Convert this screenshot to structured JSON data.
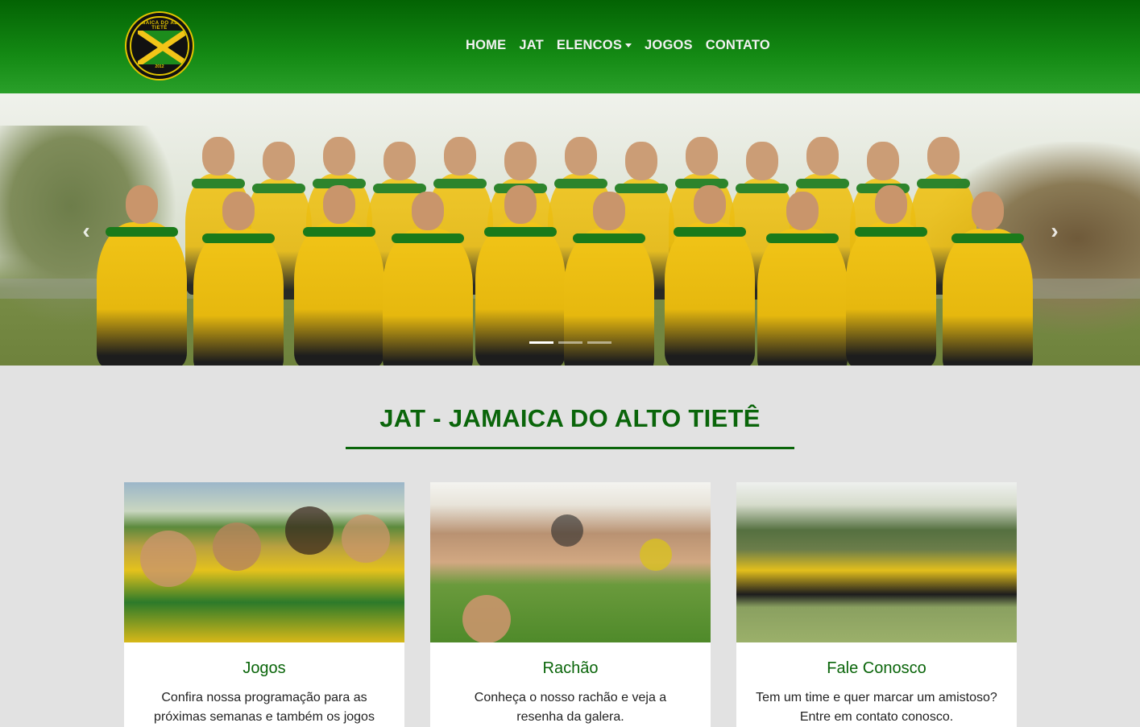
{
  "header": {
    "logo": {
      "icon": "jamaica-flag-crest",
      "ring_text": "JAMAICA DO ALTO TIETÊ",
      "year": "2012"
    },
    "nav": [
      {
        "label": "HOME"
      },
      {
        "label": "JAT"
      },
      {
        "label": "ELENCOS",
        "dropdown": true
      },
      {
        "label": "JOGOS"
      },
      {
        "label": "CONTATO"
      }
    ]
  },
  "carousel": {
    "prev_icon": "chevron-left-icon",
    "next_icon": "chevron-right-icon",
    "prev_glyph": "‹",
    "next_glyph": "›",
    "slide_count": 3,
    "active_index": 0
  },
  "main": {
    "title": "JAT - JAMAICA DO ALTO TIETÊ",
    "cards": [
      {
        "title": "Jogos",
        "text": "Confira nossa programação para as próximas semanas e também os jogos"
      },
      {
        "title": "Rachão",
        "text": "Conheça o nosso rachão e veja a resenha da galera."
      },
      {
        "title": "Fale Conosco",
        "text": "Tem um time e quer marcar um amistoso? Entre em contato conosco."
      }
    ]
  },
  "colors": {
    "brand_green": "#0a650a",
    "header_top": "#036303",
    "header_bottom": "#2aa02a",
    "page_bg": "#e2e2e2",
    "jersey_yellow": "#f2c518"
  }
}
